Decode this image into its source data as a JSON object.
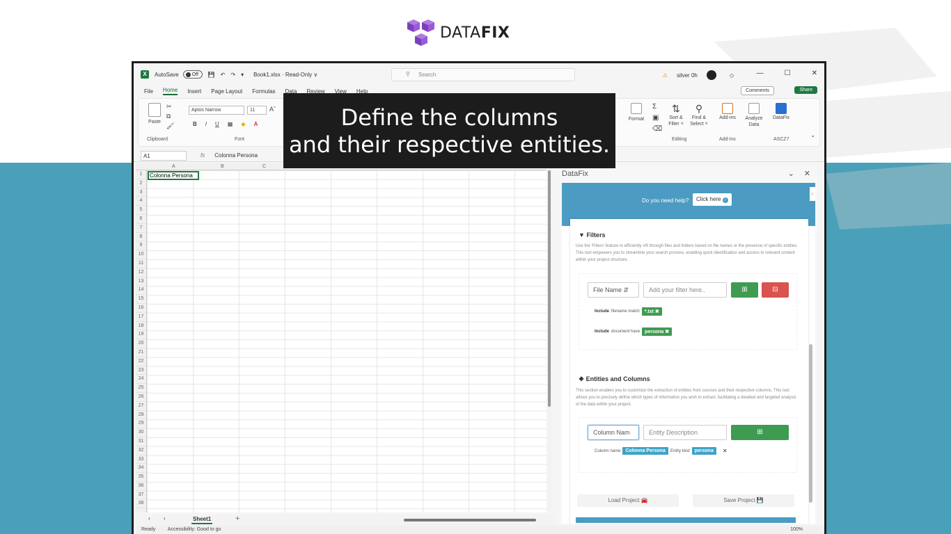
{
  "brand": {
    "name_light": "DATA",
    "name_bold": "FIX"
  },
  "caption": {
    "line1": "Define the columns",
    "line2": "and their respective entities."
  },
  "excel": {
    "autosave_label": "AutoSave",
    "autosave_state": "Off",
    "file_title": "Book1.xlsx · Read-Only ∨",
    "search_placeholder": "Search",
    "user_name": "silver 0h",
    "menu": [
      "File",
      "Home",
      "Insert",
      "Page Layout",
      "Formulas",
      "Data",
      "Review",
      "View",
      "Help"
    ],
    "comments_label": "Comments",
    "share_label": "Share",
    "ribbon": {
      "paste": "Paste",
      "clipboard": "Clipboard",
      "font_name": "Aptos Narrow",
      "font_size": "11",
      "font_group": "Font",
      "format": "Format",
      "sort_filter": "Sort & Filter ˅",
      "find_select": "Find & Select ˅",
      "editing": "Editing",
      "addins": "Add-ins",
      "addins_group": "Add-ins",
      "analyze": "Analyze Data",
      "datafix": "DataFix",
      "ascz7": "ASCZ7"
    },
    "name_box": "A1",
    "formula_value": "Colonna Persona",
    "columns": [
      "A",
      "B",
      "C"
    ],
    "rows": [
      "1",
      "2",
      "3",
      "4",
      "5",
      "6",
      "7",
      "8",
      "9",
      "10",
      "11",
      "12",
      "13",
      "14",
      "15",
      "16",
      "17",
      "18",
      "19",
      "20",
      "21",
      "22",
      "23",
      "24",
      "25",
      "26",
      "27",
      "28",
      "29",
      "30",
      "31",
      "32",
      "33",
      "34",
      "35",
      "36",
      "37",
      "38"
    ],
    "cell_a1": "Colonna Persona",
    "sheet_tab": "Sheet1",
    "status_ready": "Ready",
    "status_accessibility": "Accessibility: Good to go",
    "zoom": "100%"
  },
  "panel": {
    "title": "DataFix",
    "help_question": "Do you need help?",
    "help_button": "Click here",
    "filters": {
      "title": "Filters",
      "description": "Use the 'Filters' feature to efficiently sift through files and folders based on file names or the presence of specific entities. This tool empowers you to streamline your search process, enabling quick identification and access to relevant content within your project structure.",
      "select_value": "File Name",
      "input_placeholder": "Add your filter here..",
      "rule1_prefix": "Include",
      "rule1_text": "filename match",
      "rule1_chip": "*.txt",
      "rule2_prefix": "Include",
      "rule2_text": "document have",
      "rule2_chip": "persona"
    },
    "entities": {
      "title": "Entities and Columns",
      "description": "This section enables you to customize the extraction of entities from sources and their respective columns. This tool allows you to precisely define which types of information you wish to extract, facilitating a detailed and targeted analysis of the data within your project.",
      "column_input": "Column Nam",
      "entity_placeholder": "Entity Description",
      "row_col_label": "Column name",
      "row_col_chip": "Colonna Persona",
      "row_entity_label": "Entity kind",
      "row_entity_chip": "persona"
    },
    "load_project": "Load Project",
    "save_project": "Save Project"
  }
}
